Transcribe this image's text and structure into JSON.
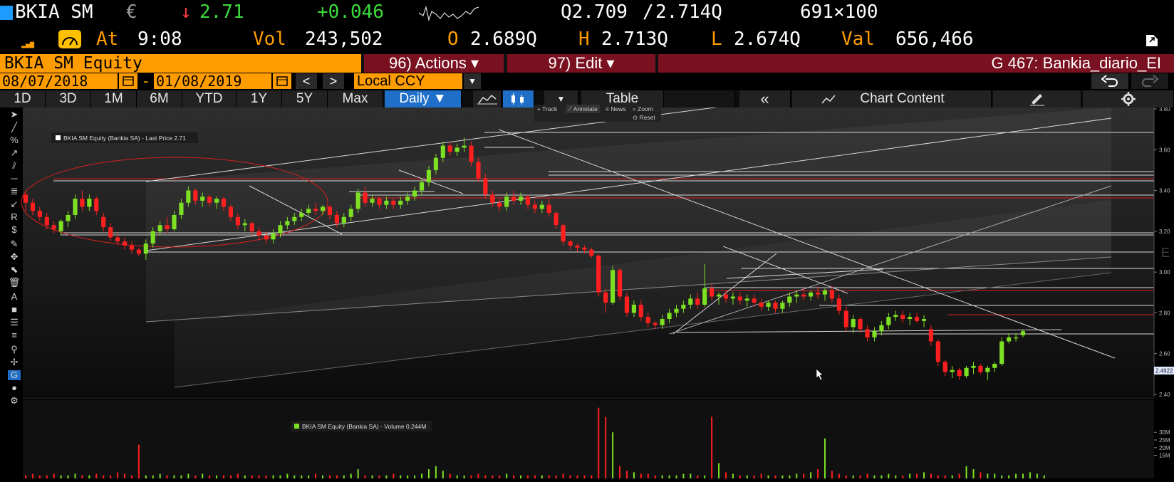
{
  "ticker": {
    "symbol": "BKIA SM",
    "currency_symbol": "€",
    "arrow": "↓",
    "last_price": "2.71",
    "change": "+0.046",
    "bid": "Q2.709",
    "slash": "/",
    "ask": "2.714Q",
    "size": "691×100",
    "at_label": "At",
    "time": "9:08",
    "vol_label": "Vol",
    "volume": "243,502",
    "open_label": "O",
    "open": "2.689Q",
    "high_label": "H",
    "high": "2.713Q",
    "low_label": "L",
    "low": "2.674Q",
    "val_label": "Val",
    "value": "656,466"
  },
  "command_bar": {
    "security": "BKIA SM Equity",
    "actions": "96) Actions ▾",
    "edit": "97) Edit ▾",
    "chart_name": "G 467: Bankia_diario_EI"
  },
  "date_bar": {
    "start_date": "08/07/2018",
    "separator": "-",
    "end_date": "01/08/2019",
    "prev": "<",
    "next": ">",
    "currency": "Local CCY",
    "undo_icon": "undo-icon",
    "redo_icon": "redo-icon"
  },
  "period_bar": {
    "periods": [
      "1D",
      "3D",
      "1M",
      "6M",
      "YTD",
      "1Y",
      "5Y",
      "Max"
    ],
    "frequency": "Daily ▼",
    "table": "Table",
    "collapse": "«",
    "chart_content": "Chart Content"
  },
  "chart_toolbar": {
    "track": "+ Track",
    "annotate": "⟋ Annotate",
    "news": "≡ News",
    "zoom": "⌕ Zoom",
    "reset": "⊙ Reset"
  },
  "chart_data": {
    "type": "candlestick",
    "price_legend": "BKIA SM Equity (Bankia SA) - Last Price 2.71",
    "volume_legend": "BKIA SM Equity (Bankia SA) - Volume 0.244M",
    "y_ticks": [
      "3.80",
      "3.60",
      "3.40",
      "3.20",
      "3.00",
      "2.80",
      "2.60",
      "2.40"
    ],
    "ylim": [
      2.4,
      3.8
    ],
    "last_price_label": "2.4922",
    "volume_ticks": [
      "30M",
      "25M",
      "20M",
      "15M"
    ],
    "side_label": "E",
    "colors": {
      "up": "#7de022",
      "down": "#ff1f1f",
      "line": "#d8d8d8",
      "red_line": "#d42020"
    },
    "ohlc": [
      [
        3.38,
        3.4,
        3.3,
        3.34
      ],
      [
        3.34,
        3.36,
        3.28,
        3.3
      ],
      [
        3.3,
        3.32,
        3.25,
        3.27
      ],
      [
        3.27,
        3.29,
        3.21,
        3.23
      ],
      [
        3.23,
        3.25,
        3.19,
        3.21
      ],
      [
        3.2,
        3.26,
        3.18,
        3.25
      ],
      [
        3.25,
        3.3,
        3.22,
        3.28
      ],
      [
        3.28,
        3.38,
        3.26,
        3.36
      ],
      [
        3.36,
        3.4,
        3.3,
        3.32
      ],
      [
        3.32,
        3.38,
        3.3,
        3.36
      ],
      [
        3.36,
        3.37,
        3.28,
        3.3
      ],
      [
        3.27,
        3.29,
        3.2,
        3.22
      ],
      [
        3.22,
        3.24,
        3.15,
        3.17
      ],
      [
        3.17,
        3.19,
        3.13,
        3.15
      ],
      [
        3.15,
        3.17,
        3.11,
        3.13
      ],
      [
        3.13,
        3.15,
        3.09,
        3.11
      ],
      [
        3.11,
        3.12,
        3.08,
        3.09
      ],
      [
        3.09,
        3.16,
        3.06,
        3.14
      ],
      [
        3.14,
        3.22,
        3.12,
        3.2
      ],
      [
        3.2,
        3.25,
        3.18,
        3.23
      ],
      [
        3.23,
        3.27,
        3.19,
        3.21
      ],
      [
        3.21,
        3.3,
        3.2,
        3.28
      ],
      [
        3.28,
        3.36,
        3.26,
        3.34
      ],
      [
        3.34,
        3.42,
        3.32,
        3.4
      ],
      [
        3.4,
        3.41,
        3.33,
        3.35
      ],
      [
        3.35,
        3.39,
        3.32,
        3.37
      ],
      [
        3.37,
        3.38,
        3.32,
        3.34
      ],
      [
        3.34,
        3.37,
        3.31,
        3.36
      ],
      [
        3.36,
        3.37,
        3.3,
        3.32
      ],
      [
        3.32,
        3.33,
        3.25,
        3.27
      ],
      [
        3.27,
        3.29,
        3.21,
        3.23
      ],
      [
        3.23,
        3.26,
        3.2,
        3.24
      ],
      [
        3.24,
        3.25,
        3.18,
        3.2
      ],
      [
        3.2,
        3.22,
        3.16,
        3.18
      ],
      [
        3.18,
        3.2,
        3.14,
        3.16
      ],
      [
        3.16,
        3.21,
        3.14,
        3.19
      ],
      [
        3.19,
        3.25,
        3.17,
        3.23
      ],
      [
        3.23,
        3.27,
        3.21,
        3.25
      ],
      [
        3.25,
        3.29,
        3.23,
        3.27
      ],
      [
        3.27,
        3.31,
        3.25,
        3.29
      ],
      [
        3.29,
        3.33,
        3.27,
        3.31
      ],
      [
        3.31,
        3.34,
        3.28,
        3.3
      ],
      [
        3.3,
        3.33,
        3.28,
        3.32
      ],
      [
        3.32,
        3.33,
        3.26,
        3.28
      ],
      [
        3.28,
        3.3,
        3.22,
        3.24
      ],
      [
        3.24,
        3.29,
        3.22,
        3.27
      ],
      [
        3.27,
        3.33,
        3.25,
        3.31
      ],
      [
        3.31,
        3.41,
        3.29,
        3.39
      ],
      [
        3.39,
        3.42,
        3.32,
        3.34
      ],
      [
        3.34,
        3.38,
        3.32,
        3.36
      ],
      [
        3.36,
        3.37,
        3.31,
        3.33
      ],
      [
        3.33,
        3.37,
        3.31,
        3.35
      ],
      [
        3.35,
        3.36,
        3.31,
        3.33
      ],
      [
        3.33,
        3.37,
        3.31,
        3.35
      ],
      [
        3.35,
        3.39,
        3.33,
        3.37
      ],
      [
        3.37,
        3.42,
        3.35,
        3.4
      ],
      [
        3.4,
        3.46,
        3.38,
        3.44
      ],
      [
        3.44,
        3.52,
        3.42,
        3.5
      ],
      [
        3.5,
        3.58,
        3.48,
        3.56
      ],
      [
        3.56,
        3.64,
        3.54,
        3.62
      ],
      [
        3.62,
        3.64,
        3.57,
        3.59
      ],
      [
        3.59,
        3.63,
        3.57,
        3.61
      ],
      [
        3.61,
        3.66,
        3.59,
        3.62
      ],
      [
        3.62,
        3.64,
        3.52,
        3.54
      ],
      [
        3.54,
        3.56,
        3.44,
        3.46
      ],
      [
        3.46,
        3.48,
        3.36,
        3.38
      ],
      [
        3.38,
        3.4,
        3.32,
        3.34
      ],
      [
        3.34,
        3.36,
        3.3,
        3.32
      ],
      [
        3.32,
        3.39,
        3.3,
        3.37
      ],
      [
        3.37,
        3.4,
        3.33,
        3.35
      ],
      [
        3.35,
        3.39,
        3.33,
        3.37
      ],
      [
        3.37,
        3.38,
        3.31,
        3.33
      ],
      [
        3.33,
        3.35,
        3.29,
        3.31
      ],
      [
        3.31,
        3.35,
        3.29,
        3.33
      ],
      [
        3.33,
        3.36,
        3.27,
        3.29
      ],
      [
        3.29,
        3.3,
        3.21,
        3.23
      ],
      [
        3.23,
        3.24,
        3.13,
        3.15
      ],
      [
        3.15,
        3.16,
        3.11,
        3.13
      ],
      [
        3.13,
        3.14,
        3.1,
        3.12
      ],
      [
        3.12,
        3.13,
        3.09,
        3.11
      ],
      [
        3.11,
        3.12,
        3.07,
        3.08
      ],
      [
        3.08,
        3.09,
        2.88,
        2.9
      ],
      [
        2.9,
        2.92,
        2.8,
        2.85
      ],
      [
        2.85,
        3.03,
        2.84,
        3.01
      ],
      [
        3.01,
        3.02,
        2.86,
        2.88
      ],
      [
        2.88,
        2.9,
        2.78,
        2.8
      ],
      [
        2.8,
        2.86,
        2.78,
        2.84
      ],
      [
        2.84,
        2.86,
        2.76,
        2.78
      ],
      [
        2.78,
        2.8,
        2.73,
        2.75
      ],
      [
        2.75,
        2.76,
        2.72,
        2.74
      ],
      [
        2.74,
        2.79,
        2.72,
        2.77
      ],
      [
        2.77,
        2.82,
        2.75,
        2.8
      ],
      [
        2.8,
        2.84,
        2.78,
        2.82
      ],
      [
        2.82,
        2.86,
        2.8,
        2.84
      ],
      [
        2.84,
        2.89,
        2.82,
        2.87
      ],
      [
        2.87,
        2.9,
        2.82,
        2.84
      ],
      [
        2.84,
        3.04,
        2.83,
        2.92
      ],
      [
        2.92,
        2.94,
        2.86,
        2.88
      ],
      [
        2.88,
        2.9,
        2.84,
        2.89
      ],
      [
        2.89,
        2.91,
        2.85,
        2.87
      ],
      [
        2.87,
        2.9,
        2.84,
        2.88
      ],
      [
        2.88,
        2.9,
        2.84,
        2.86
      ],
      [
        2.86,
        2.89,
        2.83,
        2.87
      ],
      [
        2.87,
        2.89,
        2.83,
        2.85
      ],
      [
        2.85,
        2.87,
        2.81,
        2.83
      ],
      [
        2.83,
        2.86,
        2.81,
        2.85
      ],
      [
        2.85,
        2.86,
        2.8,
        2.82
      ],
      [
        2.82,
        2.86,
        2.8,
        2.85
      ],
      [
        2.85,
        2.9,
        2.83,
        2.88
      ],
      [
        2.88,
        2.91,
        2.85,
        2.89
      ],
      [
        2.89,
        2.92,
        2.86,
        2.88
      ],
      [
        2.88,
        2.91,
        2.86,
        2.9
      ],
      [
        2.9,
        2.93,
        2.87,
        2.89
      ],
      [
        2.89,
        2.92,
        2.86,
        2.91
      ],
      [
        2.91,
        2.93,
        2.85,
        2.87
      ],
      [
        2.87,
        2.89,
        2.79,
        2.81
      ],
      [
        2.81,
        2.83,
        2.71,
        2.73
      ],
      [
        2.73,
        2.79,
        2.7,
        2.77
      ],
      [
        2.77,
        2.78,
        2.7,
        2.72
      ],
      [
        2.72,
        2.74,
        2.66,
        2.68
      ],
      [
        2.68,
        2.73,
        2.66,
        2.71
      ],
      [
        2.71,
        2.76,
        2.69,
        2.74
      ],
      [
        2.74,
        2.8,
        2.72,
        2.78
      ],
      [
        2.78,
        2.81,
        2.76,
        2.79
      ],
      [
        2.79,
        2.81,
        2.75,
        2.77
      ],
      [
        2.77,
        2.8,
        2.74,
        2.78
      ],
      [
        2.78,
        2.8,
        2.75,
        2.76
      ],
      [
        2.76,
        2.79,
        2.73,
        2.77
      ],
      [
        2.72,
        2.74,
        2.64,
        2.66
      ],
      [
        2.66,
        2.67,
        2.54,
        2.56
      ],
      [
        2.56,
        2.57,
        2.49,
        2.51
      ],
      [
        2.51,
        2.54,
        2.48,
        2.52
      ],
      [
        2.52,
        2.53,
        2.47,
        2.49
      ],
      [
        2.49,
        2.54,
        2.48,
        2.53
      ],
      [
        2.53,
        2.56,
        2.5,
        2.54
      ],
      [
        2.54,
        2.55,
        2.5,
        2.51
      ],
      [
        2.51,
        2.54,
        2.47,
        2.53
      ],
      [
        2.53,
        2.56,
        2.51,
        2.55
      ],
      [
        2.55,
        2.68,
        2.54,
        2.66
      ],
      [
        2.66,
        2.7,
        2.65,
        2.68
      ],
      [
        2.68,
        2.7,
        2.66,
        2.68
      ],
      [
        2.69,
        2.72,
        2.68,
        2.71
      ]
    ],
    "volume": [
      2,
      3,
      2,
      2,
      3,
      2,
      2,
      3,
      2,
      2,
      3,
      2,
      2,
      4,
      3,
      2,
      22,
      2,
      2,
      3,
      2,
      2,
      2,
      3,
      2,
      3,
      2,
      2,
      2,
      2,
      3,
      2,
      2,
      2,
      2,
      2,
      2,
      3,
      2,
      2,
      2,
      3,
      2,
      2,
      2,
      2,
      3,
      6,
      2,
      2,
      2,
      2,
      3,
      2,
      2,
      2,
      3,
      6,
      8,
      5,
      3,
      2,
      2,
      2,
      3,
      2,
      2,
      2,
      3,
      2,
      2,
      2,
      2,
      2,
      2,
      2,
      3,
      2,
      2,
      2,
      2,
      46,
      40,
      30,
      8,
      5,
      4,
      3,
      3,
      2,
      2,
      2,
      2,
      3,
      3,
      2,
      2,
      40,
      10,
      4,
      3,
      2,
      2,
      2,
      3,
      2,
      2,
      2,
      2,
      3,
      3,
      4,
      6,
      26,
      5,
      3,
      2,
      2,
      2,
      3,
      2,
      2,
      3,
      2,
      2,
      3,
      3,
      4,
      3,
      2,
      2,
      2,
      3,
      8,
      6,
      4,
      3,
      3,
      2,
      2,
      3,
      3,
      4,
      3,
      2
    ]
  }
}
